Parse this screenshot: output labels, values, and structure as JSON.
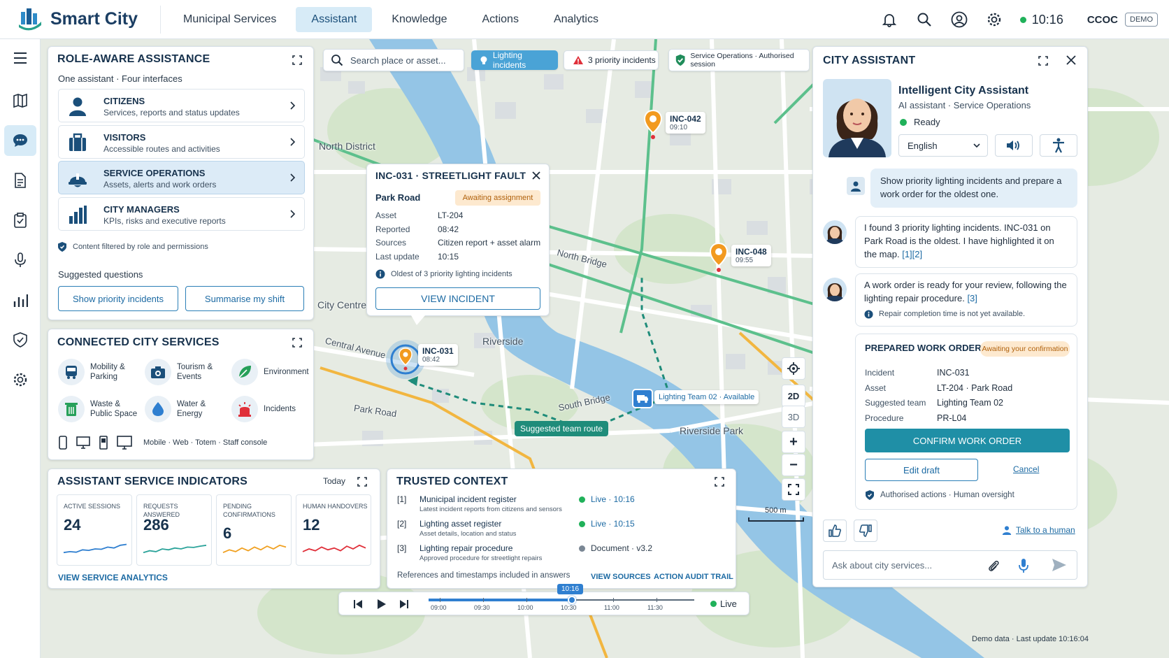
{
  "app": {
    "name": "Smart City",
    "org": "CCOC",
    "demo": "DEMO",
    "time": "10:16"
  },
  "nav": {
    "tabs": [
      "Municipal Services",
      "Assistant",
      "Knowledge",
      "Actions",
      "Analytics"
    ],
    "active": 1
  },
  "rail": {
    "icons": [
      "menu-icon",
      "map-icon",
      "chat-icon",
      "document-icon",
      "clipboard-icon",
      "microphone-icon",
      "bar-chart-icon",
      "shield-icon",
      "settings-icon"
    ],
    "active": 2
  },
  "role": {
    "title": "ROLE-AWARE ASSISTANCE",
    "subtitle": "One assistant · Four interfaces",
    "cards": [
      {
        "title": "CITIZENS",
        "desc": "Services, reports and status updates",
        "icon": "person-icon"
      },
      {
        "title": "VISITORS",
        "desc": "Accessible routes and activities",
        "icon": "suitcase-icon"
      },
      {
        "title": "SERVICE OPERATIONS",
        "desc": "Assets, alerts and work orders",
        "icon": "hardhat-icon"
      },
      {
        "title": "CITY MANAGERS",
        "desc": "KPIs, risks and executive reports",
        "icon": "bar-chart-icon"
      }
    ],
    "filter": "Content filtered by role and permissions",
    "suggested": "Suggested questions",
    "q1": "Show priority incidents",
    "q2": "Summarise my shift"
  },
  "services": {
    "title": "CONNECTED CITY SERVICES",
    "items": [
      {
        "l1": "Mobility &",
        "l2": "Parking",
        "icon": "bus-icon"
      },
      {
        "l1": "Tourism &",
        "l2": "Events",
        "icon": "camera-icon"
      },
      {
        "l1": "Environment",
        "l2": "",
        "icon": "leaf-icon"
      },
      {
        "l1": "Waste &",
        "l2": "Public Space",
        "icon": "trash-icon"
      },
      {
        "l1": "Water &",
        "l2": "Energy",
        "icon": "water-drop-icon"
      },
      {
        "l1": "Incidents",
        "l2": "",
        "icon": "alarm-icon"
      }
    ],
    "channels": "Mobile · Web · Totem · Staff console"
  },
  "indicators": {
    "title": "ASSISTANT SERVICE INDICATORS",
    "period": "Today",
    "kpis": [
      {
        "label": "ACTIVE SESSIONS",
        "value": "24",
        "color": "#2f7fd0",
        "trend": [
          0.3,
          0.35,
          0.32,
          0.45,
          0.42,
          0.5,
          0.48,
          0.6,
          0.55,
          0.7,
          0.75
        ]
      },
      {
        "label": "REQUESTS ANSWERED",
        "value": "286",
        "color": "#2ba39a",
        "trend": [
          0.3,
          0.4,
          0.35,
          0.5,
          0.45,
          0.55,
          0.5,
          0.6,
          0.58,
          0.65,
          0.7
        ]
      },
      {
        "label": "PENDING CONFIRMATIONS",
        "value": "6",
        "color": "#f0a020",
        "trend": [
          0.3,
          0.45,
          0.35,
          0.55,
          0.4,
          0.6,
          0.45,
          0.65,
          0.5,
          0.7,
          0.6
        ]
      },
      {
        "label": "HUMAN HANDOVERS",
        "value": "12",
        "color": "#e0303a",
        "trend": [
          0.35,
          0.5,
          0.4,
          0.6,
          0.45,
          0.55,
          0.4,
          0.65,
          0.5,
          0.7,
          0.55
        ]
      }
    ],
    "link": "VIEW SERVICE ANALYTICS"
  },
  "trusted": {
    "title": "TRUSTED CONTEXT",
    "refs": [
      {
        "n": "[1]",
        "t": "Municipal incident register",
        "s": "Latest incident reports from citizens and sensors",
        "st": "Live · 10:16",
        "live": true
      },
      {
        "n": "[2]",
        "t": "Lighting asset register",
        "s": "Asset details, location and status",
        "st": "Live · 10:15",
        "live": true
      },
      {
        "n": "[3]",
        "t": "Lighting repair procedure",
        "s": "Approved procedure for streetlight repairs",
        "st": "Document · v3.2",
        "live": false
      }
    ],
    "footer": "References and timestamps included in answers",
    "l1": "VIEW SOURCES",
    "l2": "ACTION AUDIT TRAIL"
  },
  "map": {
    "search": "Search place or asset...",
    "chip1": "Lighting incidents",
    "chip2": "3 priority incidents",
    "chip3": "Service Operations · Authorised session",
    "labels": {
      "north": "North District",
      "centre": "City Centre",
      "riverside": "Riverside",
      "rpark": "Riverside Park",
      "central": "Central Avenue",
      "park": "Park Road",
      "nbridge": "North Bridge",
      "sbridge": "South Bridge"
    },
    "incidents": [
      {
        "id": "INC-042",
        "time": "09:10"
      },
      {
        "id": "INC-048",
        "time": "09:55"
      },
      {
        "id": "INC-031",
        "time": "08:42"
      }
    ],
    "team": "Lighting Team 02 · Available",
    "route": "Suggested team route",
    "controls": {
      "d2": "2D",
      "d3": "3D",
      "plus": "+",
      "minus": "−"
    },
    "scale": "500 m",
    "footer": "Demo data · Last update 10:16:04"
  },
  "timeline": {
    "ticks": [
      "09:00",
      "09:30",
      "10:00",
      "10:30",
      "11:00",
      "11:30"
    ],
    "current": "10:16",
    "live": "Live"
  },
  "popup": {
    "title": "INC-031 · STREETLIGHT FAULT",
    "place": "Park Road",
    "status": "Awaiting assignment",
    "rows": [
      {
        "k": "Asset",
        "v": "LT-204"
      },
      {
        "k": "Reported",
        "v": "08:42"
      },
      {
        "k": "Sources",
        "v": "Citizen report + asset alarm"
      },
      {
        "k": "Last update",
        "v": "10:15"
      }
    ],
    "note": "Oldest of 3 priority lighting incidents",
    "action": "VIEW INCIDENT"
  },
  "assistant": {
    "title": "CITY ASSISTANT",
    "name": "Intelligent City Assistant",
    "role": "AI assistant · Service Operations",
    "status": "Ready",
    "lang": "English",
    "user_msg": "Show priority lighting incidents and prepare a work order for the oldest one.",
    "reply1": "I found 3 priority lighting incidents. INC-031 on Park Road is the oldest. I have highlighted it on the map.",
    "reply1_cite": "[1][2]",
    "reply2": "A work order is ready for your review, following the lighting repair procedure.",
    "reply2_cite": "[3]",
    "note": "Repair completion time is not yet available.",
    "wo": {
      "title": "PREPARED WORK ORDER",
      "badge": "Awaiting your confirmation",
      "rows": [
        {
          "k": "Incident",
          "v": "INC-031"
        },
        {
          "k": "Asset",
          "v": "LT-204 · Park Road"
        },
        {
          "k": "Suggested team",
          "v": "Lighting Team 02"
        },
        {
          "k": "Procedure",
          "v": "PR-L04"
        }
      ],
      "confirm": "CONFIRM WORK ORDER",
      "edit": "Edit draft",
      "cancel": "Cancel",
      "footer": "Authorised actions · Human oversight"
    },
    "human": "Talk to a human",
    "input_ph": "Ask about city services..."
  }
}
